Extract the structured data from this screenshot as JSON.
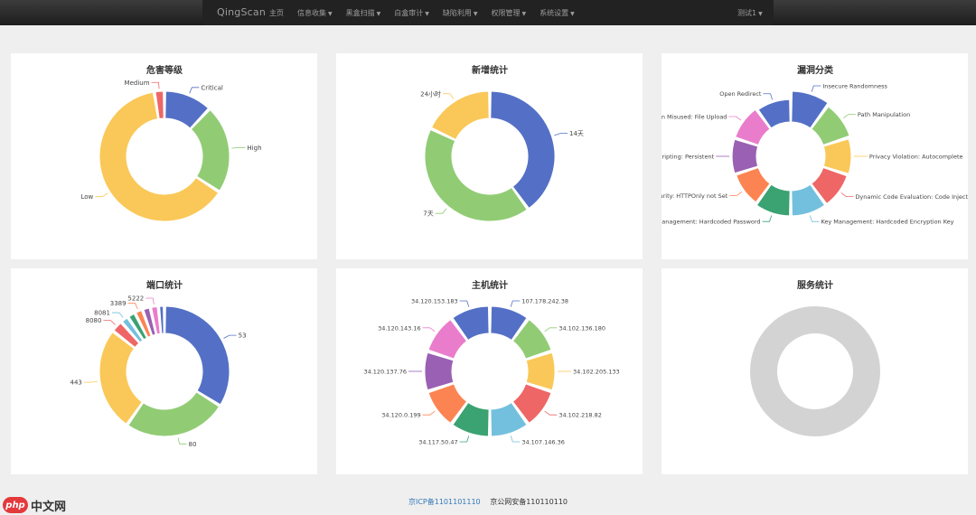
{
  "navbar": {
    "brand": "QingScan",
    "menu": [
      {
        "label": "主页",
        "dropdown": false
      },
      {
        "label": "信息收集",
        "dropdown": true
      },
      {
        "label": "黑盒扫描",
        "dropdown": true
      },
      {
        "label": "白盒审计",
        "dropdown": true
      },
      {
        "label": "缺陷利用",
        "dropdown": true
      },
      {
        "label": "权限管理",
        "dropdown": true
      },
      {
        "label": "系统设置",
        "dropdown": true
      }
    ],
    "user": "测试1",
    "caret": "▼"
  },
  "panels": [
    {
      "title": "危害等级"
    },
    {
      "title": "新增统计"
    },
    {
      "title": "漏洞分类"
    },
    {
      "title": "端口统计"
    },
    {
      "title": "主机统计"
    },
    {
      "title": "服务统计"
    }
  ],
  "footer": {
    "icp": "京ICP备1101101110",
    "police": "京公网安备110110110"
  },
  "logo": {
    "circle": "php",
    "text": "中文网"
  },
  "chart_data": [
    {
      "type": "pie",
      "title": "危害等级",
      "series": [
        {
          "name": "Critical",
          "value": 12
        },
        {
          "name": "High",
          "value": 22
        },
        {
          "name": "Low",
          "value": 63
        },
        {
          "name": "Medium",
          "value": 2.5
        }
      ]
    },
    {
      "type": "pie",
      "title": "新增统计",
      "series": [
        {
          "name": "14天",
          "value": 40
        },
        {
          "name": "7天",
          "value": 42
        },
        {
          "name": "24小时",
          "value": 18
        }
      ]
    },
    {
      "type": "pie",
      "title": "漏洞分类",
      "series": [
        {
          "name": "Insecure Randomness",
          "value": 15
        },
        {
          "name": "Path Manipulation",
          "value": 12
        },
        {
          "name": "Privacy Violation: Autocomplete",
          "value": 10
        },
        {
          "name": "Dynamic Code Evaluation: Code Injection",
          "value": 9
        },
        {
          "name": "Key Management: Hardcoded Encryption Key",
          "value": 9
        },
        {
          "name": "Password Management: Hardcoded Password",
          "value": 9
        },
        {
          "name": "Cookie Security: HTTPOnly not Set",
          "value": 7
        },
        {
          "name": "Cross-Site Scripting: Persistent",
          "value": 8
        },
        {
          "name": "Often Misused: File Upload",
          "value": 8
        },
        {
          "name": "Open Redirect",
          "value": 6
        }
      ]
    },
    {
      "type": "pie",
      "title": "端口统计",
      "series": [
        {
          "name": "53",
          "value": 34
        },
        {
          "name": "80",
          "value": 26
        },
        {
          "name": "443",
          "value": 26
        },
        {
          "name": "8080",
          "value": 3
        },
        {
          "name": "8081",
          "value": 2
        },
        {
          "name": "",
          "value": 2
        },
        {
          "name": "3389",
          "value": 2
        },
        {
          "name": "",
          "value": 2
        },
        {
          "name": "5222",
          "value": 2
        },
        {
          "name": "",
          "value": 1.5
        }
      ]
    },
    {
      "type": "pie",
      "title": "主机统计",
      "series": [
        {
          "name": "107.178.242.38",
          "value": 1
        },
        {
          "name": "34.102.136.180",
          "value": 1
        },
        {
          "name": "34.102.205.133",
          "value": 1
        },
        {
          "name": "34.102.218.82",
          "value": 1
        },
        {
          "name": "34.107.146.36",
          "value": 1
        },
        {
          "name": "34.117.50.47",
          "value": 1
        },
        {
          "name": "34.120.0.199",
          "value": 1
        },
        {
          "name": "34.120.137.76",
          "value": 1
        },
        {
          "name": "34.120.143.16",
          "value": 1
        },
        {
          "name": "34.120.153.183",
          "value": 1
        }
      ]
    },
    {
      "type": "pie",
      "title": "服务统计",
      "series": []
    }
  ],
  "colors": {
    "palette": [
      "#5470c6",
      "#91cc75",
      "#fac858",
      "#ee6666",
      "#73c0de",
      "#3ba272",
      "#fc8452",
      "#9a60b4",
      "#ea7ccc"
    ],
    "empty": "#d3d3d3"
  }
}
